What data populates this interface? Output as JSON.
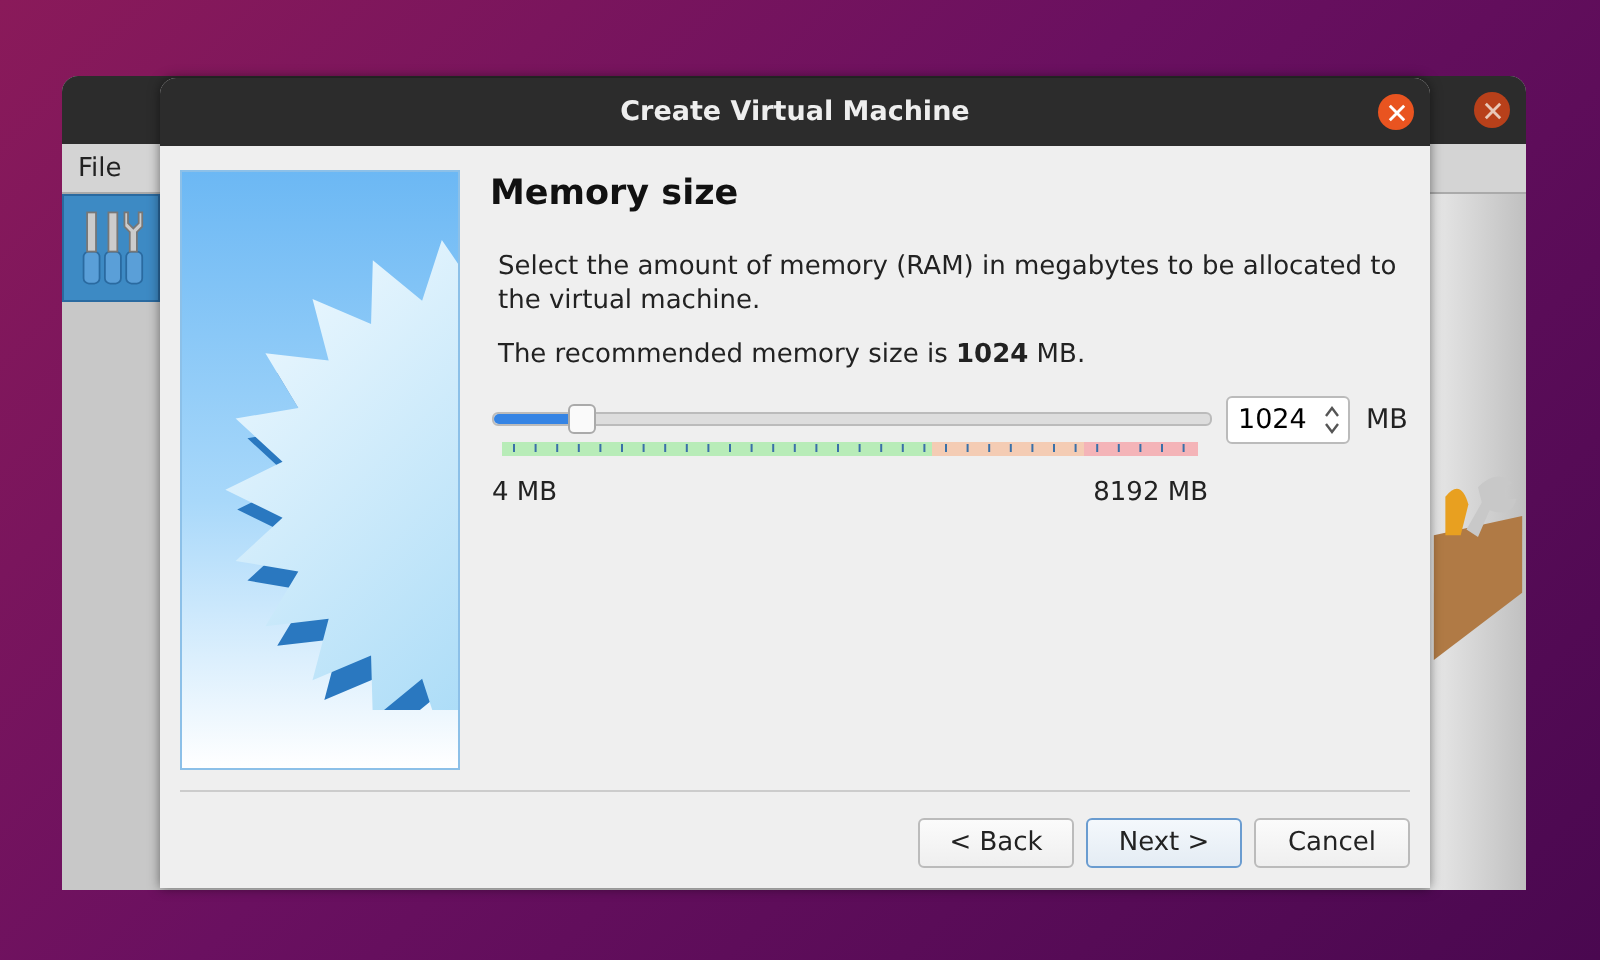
{
  "back_window": {
    "menu": [
      {
        "label": "File"
      }
    ]
  },
  "dialog": {
    "title": "Create Virtual Machine",
    "heading": "Memory size",
    "description": "Select the amount of memory (RAM) in megabytes to be allocated to the virtual machine.",
    "recommendation": "The recommended memory size is **1024** MB.",
    "memory_slider": {
      "level": 0.125,
      "min_label": "4 MB",
      "max_label": "8192 MB"
    },
    "memory_field": {
      "value": "1024",
      "unit": "MB"
    },
    "buttons": [
      {
        "label": "< Back",
        "kind": "normal"
      },
      {
        "label": "Next >",
        "kind": "default"
      },
      {
        "label": "Cancel",
        "kind": "normal"
      }
    ]
  }
}
